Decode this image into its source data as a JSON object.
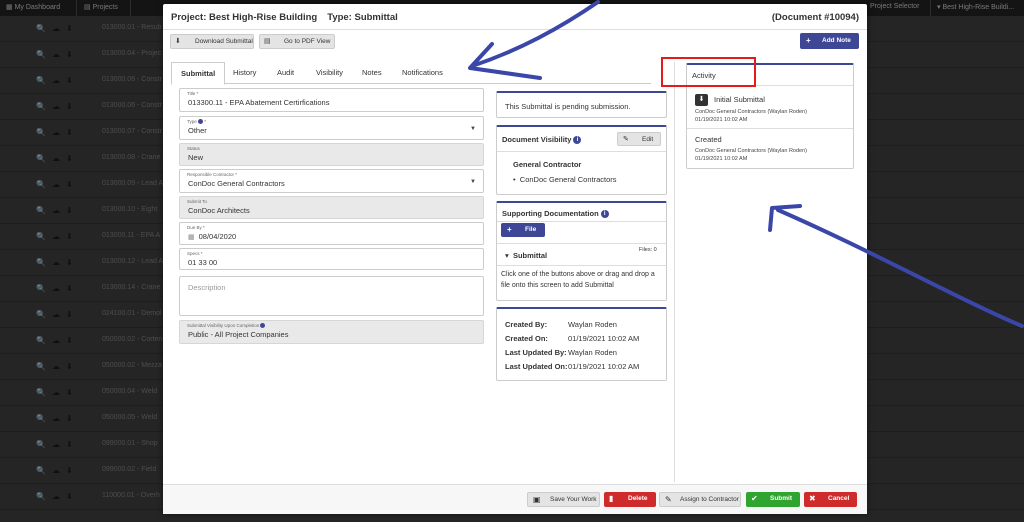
{
  "background": {
    "topbar": {
      "my_dashboard": "My Dashboard",
      "projects": "Projects",
      "project_selector": "Project Selector",
      "current_project": "Best High-Rise Buildi..."
    },
    "rows": [
      "013000.01 - Resub",
      "013000.04 - Projec",
      "013000.06 - Constr",
      "013000.06 - Constr",
      "013000.07 - Constr",
      "013000.08 - Crane",
      "013000.09 - Lead A",
      "013000.10 - Eight",
      "013000.11 - EPA A",
      "013000.12 - Lead A",
      "013000.14 - Crane",
      "024100.01 - Demol",
      "050000.02 - Corten",
      "050000.02 - Mezza",
      "050000.04 - Weld",
      "050000.05 - Weld",
      "099000.01 - Shop",
      "099000.02 - Field",
      "110000.01 - Overh"
    ]
  },
  "modal": {
    "project_title": "Project: Best High-Rise Building",
    "type_title": "Type: Submittal",
    "document_number": "(Document #10094)",
    "toolbar": {
      "download_label": "Download Submittal",
      "pdf_label": "Go to PDF View",
      "add_note_label": "Add Note"
    },
    "tabs": [
      "Submittal",
      "History",
      "Audit",
      "Visibility",
      "Notes",
      "Notifications"
    ],
    "form": {
      "title": {
        "label": "Title",
        "value": "013300.11 - EPA Abatement Certirfications"
      },
      "type": {
        "label": "Type",
        "value": "Other"
      },
      "status": {
        "label": "Status",
        "value": "New"
      },
      "responsible_contractor": {
        "label": "Responsible Contractor",
        "value": "ConDoc General Contractors"
      },
      "submit_to": {
        "label": "Submit To",
        "value": "ConDoc Architects"
      },
      "due_by": {
        "label": "Due By",
        "value": "08/04/2020"
      },
      "specs": {
        "label": "Specs",
        "value": "01 33 00"
      },
      "description": {
        "placeholder": "Description"
      },
      "visibility": {
        "label": "Submittal Visibility Upon Completion",
        "value": "Public - All Project Companies"
      }
    },
    "pending_text": "This Submittal is pending submission.",
    "doc_visibility": {
      "title": "Document Visibility",
      "edit_label": "Edit",
      "group": "General Contractor",
      "member": "ConDoc General Contractors"
    },
    "supporting": {
      "title": "Supporting Documentation",
      "file_label": "File",
      "section": "Submittal",
      "files_count": "Files: 0",
      "drop_text_1": "Click one of the buttons above or drag and drop a",
      "drop_text_2": "file onto this screen to add Submittal"
    },
    "meta": {
      "created_by_label": "Created By:",
      "created_by": "Waylan Roden",
      "created_on_label": "Created On:",
      "created_on": "01/19/2021 10:02 AM",
      "updated_by_label": "Last Updated By:",
      "updated_by": "Waylan Roden",
      "updated_on_label": "Last Updated On:",
      "updated_on": "01/19/2021 10:02 AM"
    },
    "activity": {
      "title": "Activity",
      "items": [
        {
          "label": "Initial Submittal",
          "who": "ConDoc General Contractors (Waylan Roden)",
          "when": "01/19/2021 10:02 AM"
        },
        {
          "label": "Created",
          "who": "ConDoc General Contractors (Waylan Roden)",
          "when": "01/19/2021 10:02 AM"
        }
      ]
    },
    "footer": {
      "save_label": "Save Your Work",
      "delete_label": "Delete",
      "assign_label": "Assign to Contractor",
      "submit_label": "Submit",
      "cancel_label": "Cancel"
    }
  },
  "colors": {
    "primary": "#3d4796",
    "danger": "#d02b2b",
    "success": "#2fa52f",
    "annotation_box": "#e31b1b",
    "annotation_arrow": "#3a47a8"
  }
}
